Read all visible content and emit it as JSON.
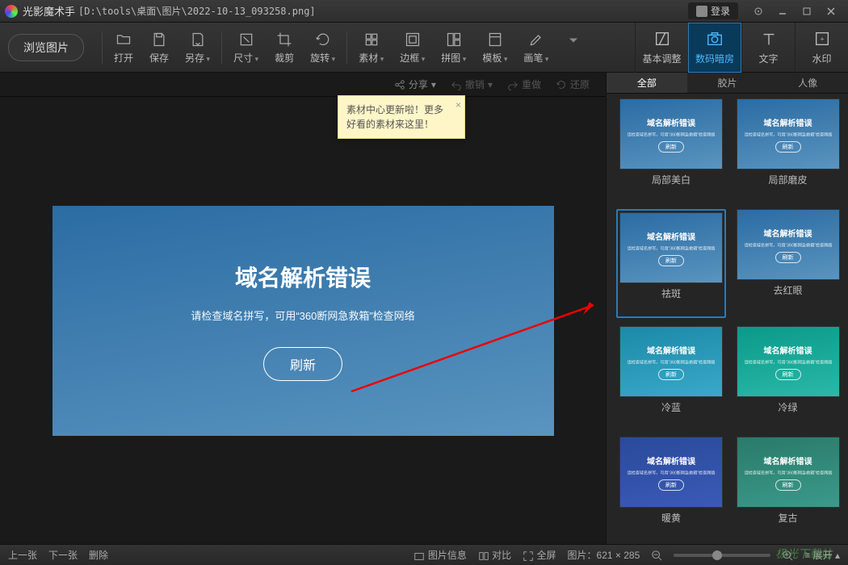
{
  "titlebar": {
    "app_name": "光影魔术手",
    "file_path": "[D:\\tools\\桌面\\图片\\2022-10-13_093258.png]",
    "login": "登录"
  },
  "toolbar": {
    "browse": "浏览图片",
    "open": "打开",
    "save": "保存",
    "saveas": "另存",
    "size": "尺寸",
    "crop": "裁剪",
    "rotate": "旋转",
    "material": "素材",
    "border": "边框",
    "collage": "拼图",
    "template": "模板",
    "brush": "画笔"
  },
  "right_tabs": {
    "basic": "基本调整",
    "darkroom": "数码暗房",
    "text": "文字",
    "watermark": "水印"
  },
  "secondbar": {
    "share": "分享",
    "undo": "撤销",
    "redo": "重做",
    "restore": "还原"
  },
  "tooltip": {
    "line1": "素材中心更新啦！更多",
    "line2": "好看的素材来这里！"
  },
  "image": {
    "title": "域名解析错误",
    "subtitle": "请检查域名拼写，可用“360断网急救箱”检查网络",
    "button": "刷新"
  },
  "subtabs": {
    "all": "全部",
    "film": "胶片",
    "portrait": "人像"
  },
  "presets": [
    {
      "label": "局部美白",
      "bg": "linear-gradient(170deg,#2b6ca3,#5a94bf)"
    },
    {
      "label": "局部磨皮",
      "bg": "linear-gradient(170deg,#2b6ca3,#5a94bf)"
    },
    {
      "label": "祛斑",
      "bg": "linear-gradient(170deg,#2b6ca3,#5a94bf)",
      "selected": true
    },
    {
      "label": "去红眼",
      "bg": "linear-gradient(170deg,#2b6ca3,#5a94bf)"
    },
    {
      "label": "冷蓝",
      "bg": "linear-gradient(170deg,#1b8aa8,#3aa8c8)"
    },
    {
      "label": "冷绿",
      "bg": "linear-gradient(170deg,#0a9a8a,#2ab8a8)"
    },
    {
      "label": "暖黄",
      "bg": "linear-gradient(170deg,#2a4a9a,#3a5ab8)"
    },
    {
      "label": "复古",
      "bg": "linear-gradient(170deg,#2a7a6a,#3a9a8a)"
    }
  ],
  "thumb_text": {
    "t1": "域名解析错误",
    "t2": "请检查域名拼写，可用“360断网急救箱”检查网络",
    "t3": "刷新"
  },
  "statusbar": {
    "prev": "上一张",
    "next": "下一张",
    "delete": "删除",
    "info": "图片信息",
    "compare": "对比",
    "fullscreen": "全屏",
    "size": "图片：621 × 285",
    "expand": "展开"
  },
  "watermark_text": "极光下载站"
}
